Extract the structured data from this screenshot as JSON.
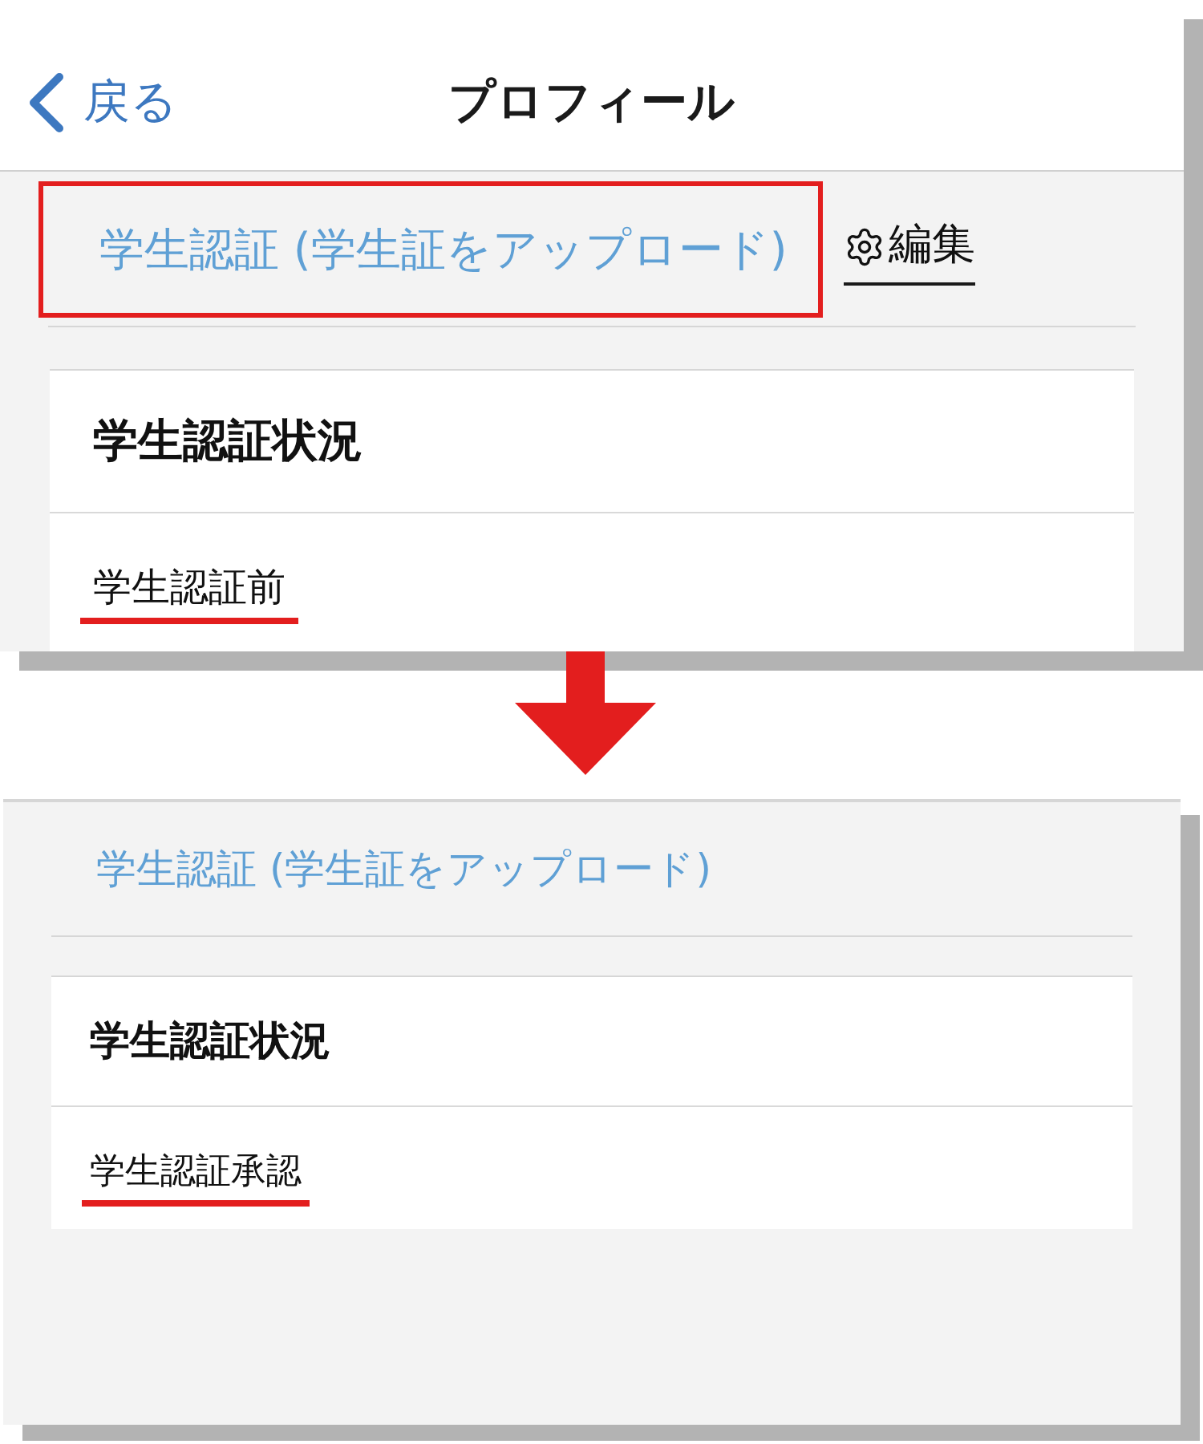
{
  "screens": [
    {
      "header": {
        "back": "戻る",
        "title": "プロフィール"
      },
      "section_title": {
        "text": "学生認証 (学生証をアップロード)",
        "highlighted": true
      },
      "edit": {
        "label": "編集"
      },
      "card": {
        "heading": "学生認証状況",
        "status": {
          "text": "学生認証前",
          "underlined": true
        }
      }
    },
    {
      "section_title": {
        "text": "学生認証 (学生証をアップロード)",
        "highlighted": false
      },
      "card": {
        "heading": "学生認証状況",
        "status": {
          "text": "学生認証承認",
          "underlined": true
        }
      }
    }
  ]
}
